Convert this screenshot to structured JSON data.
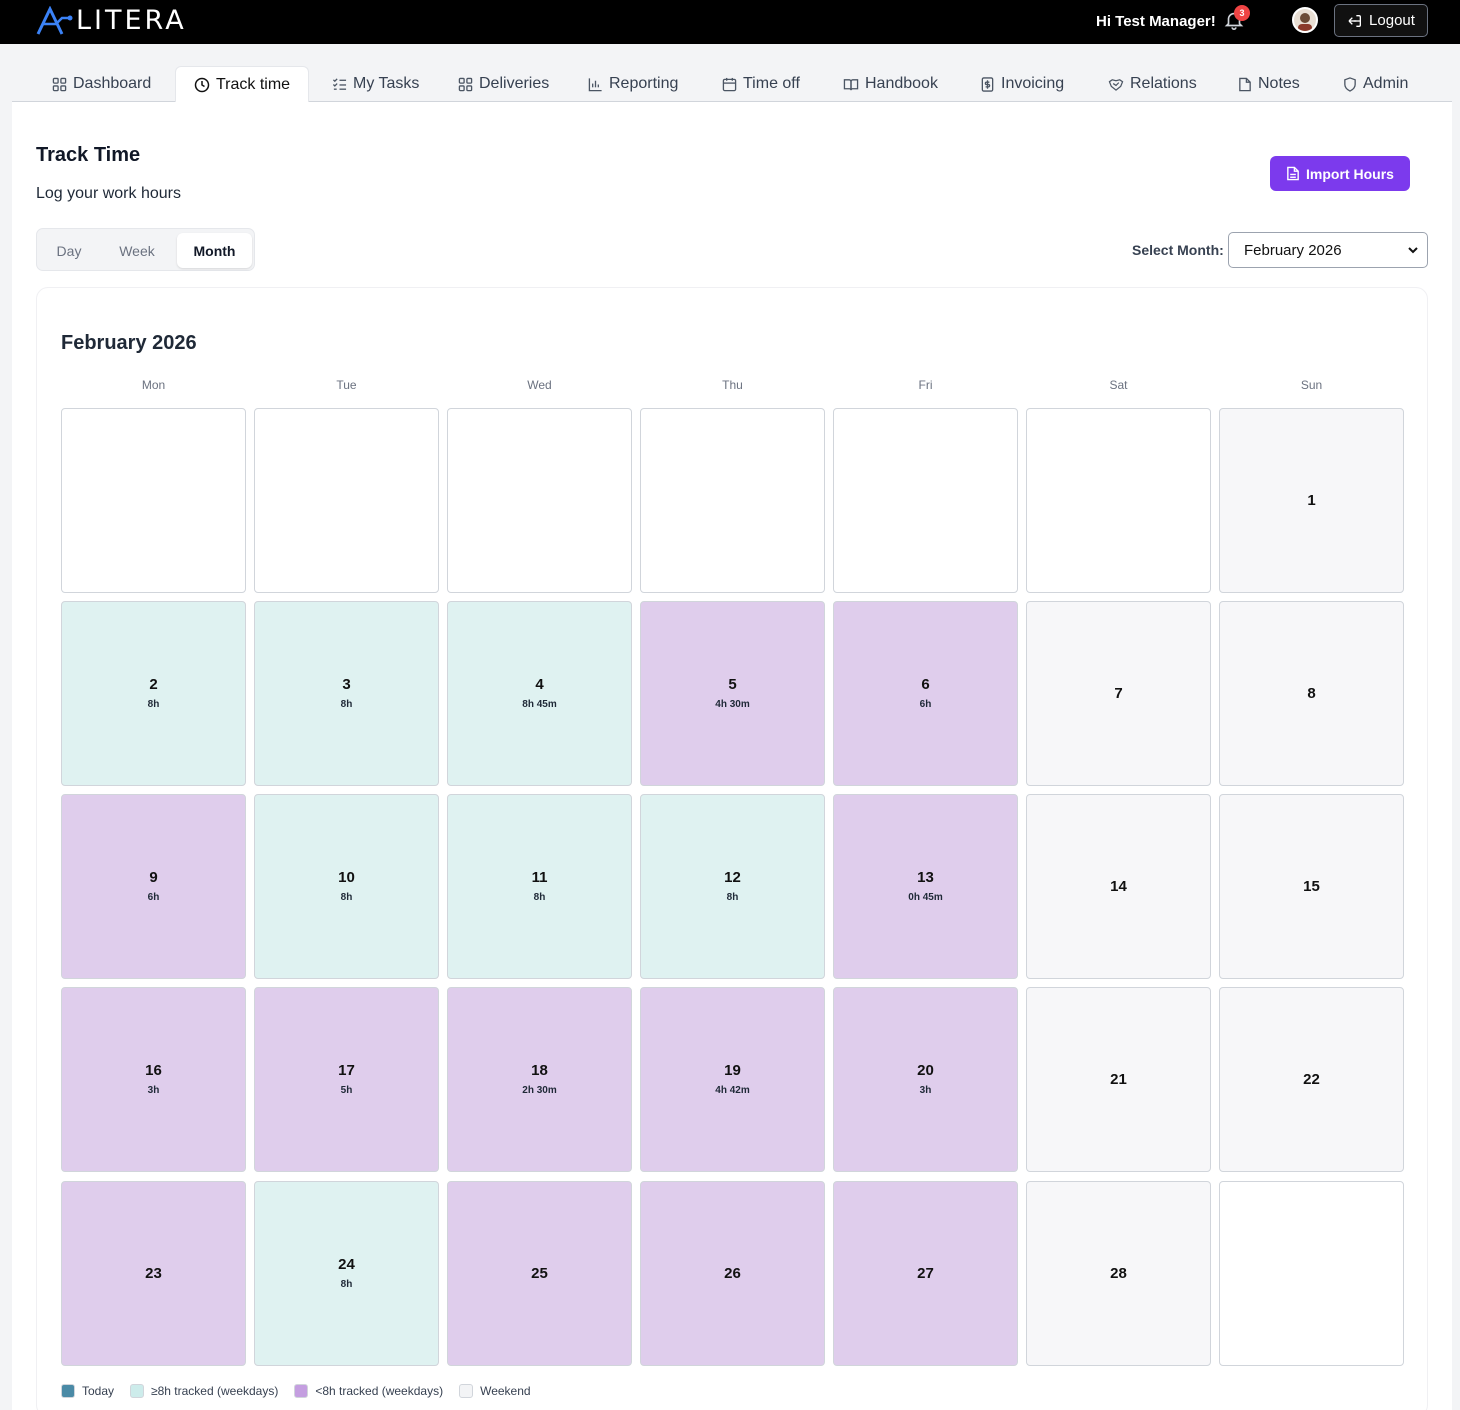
{
  "app": {
    "logo_text": "LITERA"
  },
  "header": {
    "greeting": "Hi Test Manager!",
    "notification_count": "3",
    "logout_label": "Logout"
  },
  "tabs": [
    {
      "label": "Dashboard",
      "icon": "grid-icon",
      "active": false
    },
    {
      "label": "Track time",
      "icon": "clock-icon",
      "active": true
    },
    {
      "label": "My Tasks",
      "icon": "checklist-icon",
      "active": false
    },
    {
      "label": "Deliveries",
      "icon": "grid-icon",
      "active": false
    },
    {
      "label": "Reporting",
      "icon": "bar-chart-icon",
      "active": false
    },
    {
      "label": "Time off",
      "icon": "calendar-icon",
      "active": false
    },
    {
      "label": "Handbook",
      "icon": "book-icon",
      "active": false
    },
    {
      "label": "Invoicing",
      "icon": "invoice-icon",
      "active": false
    },
    {
      "label": "Relations",
      "icon": "handshake-icon",
      "active": false
    },
    {
      "label": "Notes",
      "icon": "note-icon",
      "active": false
    },
    {
      "label": "Admin",
      "icon": "shield-icon",
      "active": false
    }
  ],
  "page": {
    "title": "Track Time",
    "subtitle": "Log your work hours",
    "import_label": "Import Hours",
    "views": [
      "Day",
      "Week",
      "Month"
    ],
    "active_view": "Month",
    "select_month_label": "Select Month:",
    "selected_month": "February 2026"
  },
  "calendar": {
    "title": "February 2026",
    "weekdays": [
      "Mon",
      "Tue",
      "Wed",
      "Thu",
      "Fri",
      "Sat",
      "Sun"
    ],
    "weeks": [
      [
        {
          "day": "",
          "hours": "",
          "status": "blank"
        },
        {
          "day": "",
          "hours": "",
          "status": "blank"
        },
        {
          "day": "",
          "hours": "",
          "status": "blank"
        },
        {
          "day": "",
          "hours": "",
          "status": "blank"
        },
        {
          "day": "",
          "hours": "",
          "status": "blank"
        },
        {
          "day": "",
          "hours": "",
          "status": "blank"
        },
        {
          "day": "1",
          "hours": "",
          "status": "weekend"
        }
      ],
      [
        {
          "day": "2",
          "hours": "8h",
          "status": "full"
        },
        {
          "day": "3",
          "hours": "8h",
          "status": "full"
        },
        {
          "day": "4",
          "hours": "8h 45m",
          "status": "full"
        },
        {
          "day": "5",
          "hours": "4h 30m",
          "status": "partial"
        },
        {
          "day": "6",
          "hours": "6h",
          "status": "partial"
        },
        {
          "day": "7",
          "hours": "",
          "status": "weekend"
        },
        {
          "day": "8",
          "hours": "",
          "status": "weekend"
        }
      ],
      [
        {
          "day": "9",
          "hours": "6h",
          "status": "partial"
        },
        {
          "day": "10",
          "hours": "8h",
          "status": "full"
        },
        {
          "day": "11",
          "hours": "8h",
          "status": "full"
        },
        {
          "day": "12",
          "hours": "8h",
          "status": "full"
        },
        {
          "day": "13",
          "hours": "0h 45m",
          "status": "partial"
        },
        {
          "day": "14",
          "hours": "",
          "status": "weekend"
        },
        {
          "day": "15",
          "hours": "",
          "status": "weekend"
        }
      ],
      [
        {
          "day": "16",
          "hours": "3h",
          "status": "partial"
        },
        {
          "day": "17",
          "hours": "5h",
          "status": "partial"
        },
        {
          "day": "18",
          "hours": "2h 30m",
          "status": "partial"
        },
        {
          "day": "19",
          "hours": "4h 42m",
          "status": "partial"
        },
        {
          "day": "20",
          "hours": "3h",
          "status": "partial"
        },
        {
          "day": "21",
          "hours": "",
          "status": "weekend"
        },
        {
          "day": "22",
          "hours": "",
          "status": "weekend"
        }
      ],
      [
        {
          "day": "23",
          "hours": "",
          "status": "partial"
        },
        {
          "day": "24",
          "hours": "8h",
          "status": "full"
        },
        {
          "day": "25",
          "hours": "",
          "status": "partial"
        },
        {
          "day": "26",
          "hours": "",
          "status": "partial"
        },
        {
          "day": "27",
          "hours": "",
          "status": "partial"
        },
        {
          "day": "28",
          "hours": "",
          "status": "weekend"
        },
        {
          "day": "",
          "hours": "",
          "status": "blank"
        }
      ]
    ]
  },
  "legend": [
    {
      "label": "Today",
      "color": "#4a8aa6"
    },
    {
      "label": "≥8h tracked (weekdays)",
      "color": "#cdeceb"
    },
    {
      "label": "<8h tracked (weekdays)",
      "color": "#c49ee0"
    },
    {
      "label": "Weekend",
      "color": "#f3f4f6"
    }
  ],
  "colors": {
    "accent": "#7c3aed",
    "full_day": "#dff2f1",
    "partial_day": "#dfcdec",
    "weekend_day": "#f7f7f9"
  }
}
